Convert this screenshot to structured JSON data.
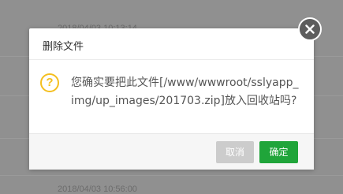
{
  "background": {
    "rows": [
      "2018/04/03 10:13:14",
      "2018/04/03 10:56:00"
    ]
  },
  "dialog": {
    "title": "删除文件",
    "message": "您确实要把此文件[/www/wwwroot/sslyapp_img/up_images/201703.zip]放入回收站吗?",
    "icon": "question-icon",
    "icon_glyph": "?",
    "close_icon": "close-icon",
    "buttons": {
      "cancel_label": "取消",
      "confirm_label": "确定"
    },
    "colors": {
      "confirm": "#20a53a",
      "cancel": "#cccccc",
      "question_icon": "#f4bf1f",
      "close_button": "#5d5d5d"
    }
  }
}
